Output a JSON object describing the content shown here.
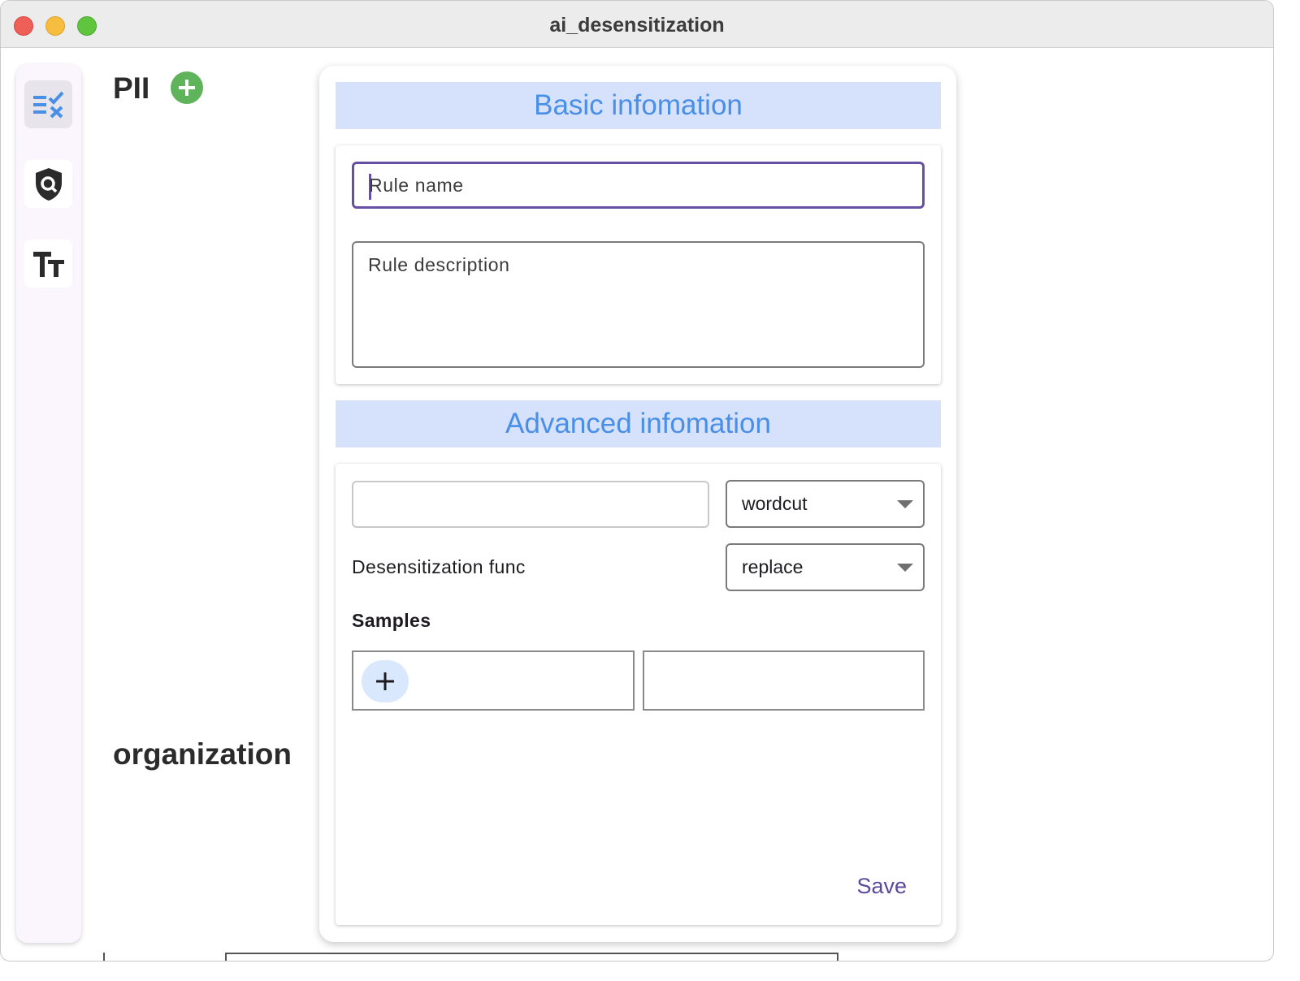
{
  "window": {
    "title": "ai_desensitization"
  },
  "nav_rail": {
    "items": [
      {
        "icon": "rule-list-icon",
        "active": true
      },
      {
        "icon": "shield-search-icon",
        "active": false
      },
      {
        "icon": "text-size-icon",
        "active": false
      }
    ]
  },
  "sections": {
    "pii_heading": "PII",
    "organization_heading": "organization"
  },
  "dialog": {
    "basic_banner": "Basic infomation",
    "rule_name_placeholder": "Rule name",
    "rule_description_placeholder": "Rule description",
    "advanced_banner": "Advanced infomation",
    "pattern_value": "",
    "method_select": {
      "selected": "wordcut"
    },
    "desensitization_label": "Desensitization func",
    "func_select": {
      "selected": "replace"
    },
    "samples_label": "Samples",
    "sample_input_value": "",
    "sample_output_value": "",
    "save_label": "Save"
  },
  "colors": {
    "accent": "#6750a4",
    "banner_bg": "#d6e1fb",
    "banner_text": "#4a8fe6",
    "add_green": "#5fb35a"
  }
}
